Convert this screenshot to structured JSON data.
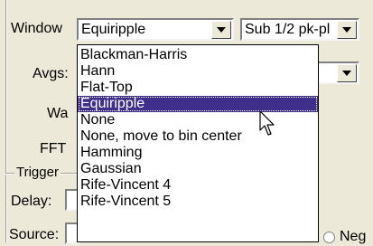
{
  "window_label": "Window",
  "window_value": "Equiripple",
  "sub_value": "Sub 1/2 pk-pl",
  "avgs_label": "Avgs:",
  "wa_label": "Wa",
  "fft_label": "FFT",
  "trigger_label": "Trigger",
  "delay_label": "Delay:",
  "source_label": "Source:",
  "neg_label": "Neg",
  "window_options": [
    "Blackman-Harris",
    "Hann",
    "Flat-Top",
    "Equiripple",
    "None",
    "None, move to bin center",
    "Hamming",
    "Gaussian",
    "Rife-Vincent 4",
    "Rife-Vincent 5"
  ],
  "selected_option": "Equiripple",
  "colors": {
    "selection": "#3f2e8a",
    "background": "#ece9d8"
  },
  "icons": {
    "combo_arrow": "chevron-down-icon",
    "cursor": "mouse-pointer-icon"
  }
}
